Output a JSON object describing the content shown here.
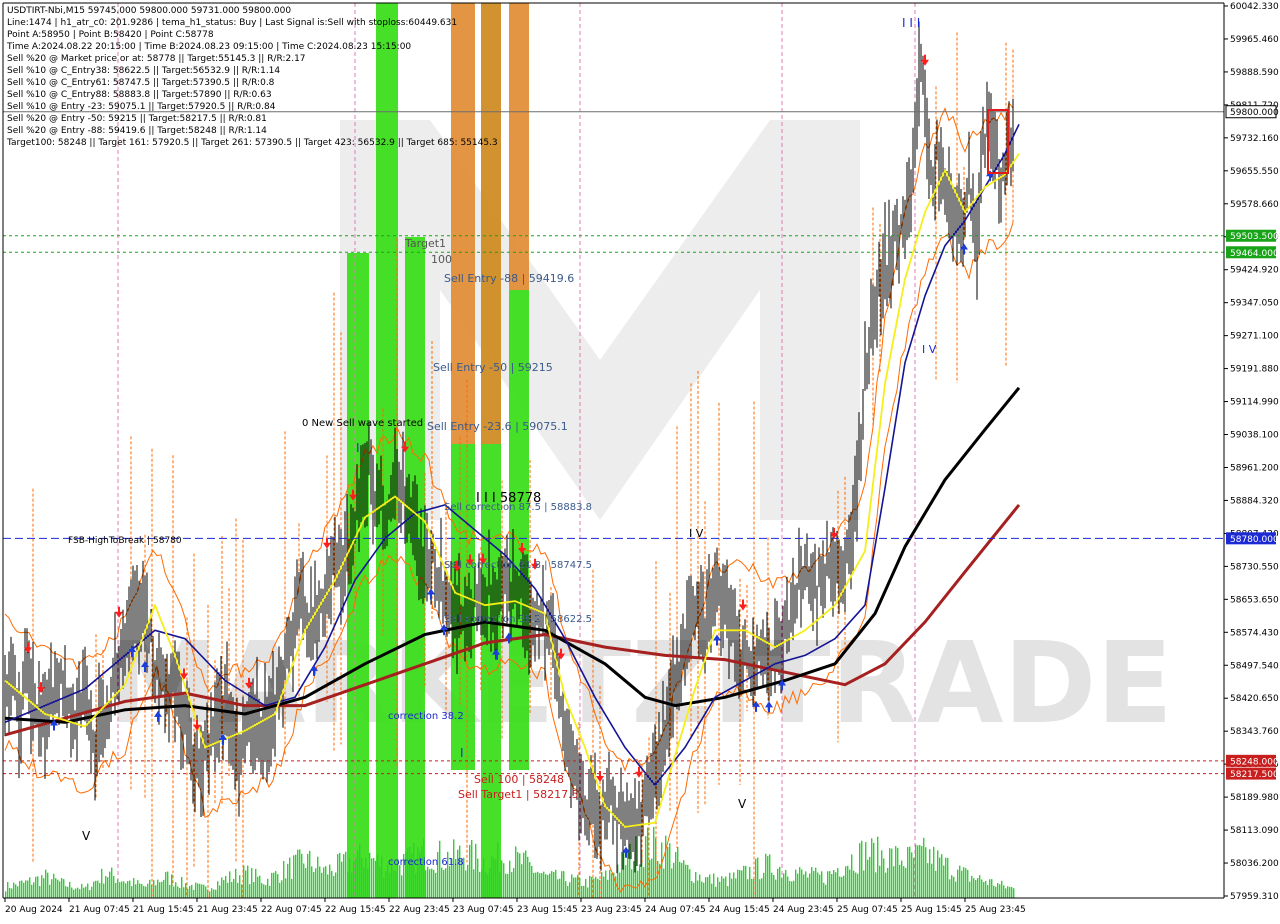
{
  "colors": {
    "background": "#ffffff",
    "axis": "#000000",
    "candle": "#000000",
    "ma_yellow": "#f5ee1a",
    "ma_blue": "#141496",
    "ma_black": "#000000",
    "ma_darkred": "#a5201e",
    "fib_orange": "#ff6a00",
    "zone_green": "#33dd11",
    "zone_orange": "#e08a30",
    "price_tag_blue": "#1c2ad4",
    "price_tag_green": "#18a318",
    "price_tag_red": "#c81e1e",
    "volume": "#33cc33",
    "arrow_sell": "#ff1e1e",
    "arrow_buy": "#1c3cdc",
    "current_price_tag": "#ffffff"
  },
  "header": {
    "lines": [
      "USDTIRT-Nbi,M15  59745.000 59800.000 59731.000 59800.000",
      "Line:1474  |  h1_atr_c0: 201.9286  |  tema_h1_status: Buy  |  Last Signal is:Sell with stoploss:60449.631",
      "Point A:58950  |  Point B:58420  |  Point C:58778",
      "Time A:2024.08.22 20:15:00  |  Time B:2024.08.23 09:15:00  |  Time C:2024.08.23 15:15:00",
      "Sell %20 @ Market price or at: 58778  ||  Target:55145.3  ||  R/R:2.17",
      "Sell %10 @ C_Entry38: 58622.5  ||  Target:56532.9  ||  R/R:1.14",
      "Sell %10 @ C_Entry61: 58747.5  ||  Target:57390.5  ||  R/R:0.8",
      "Sell %10 @ C_Entry88: 58883.8  ||  Target:57890  ||  R/R:0.63",
      "Sell %10 @ Entry -23: 59075.1  ||  Target:57920.5  ||  R/R:0.84",
      "Sell %20 @ Entry -50: 59215  ||  Target:58217.5  ||  R/R:0.81",
      "Sell %20 @ Entry -88: 59419.6  ||  Target:58248  ||  R/R:1.14",
      "Target100: 58248  ||  Target 161: 57920.5  ||  Target 261: 57390.5  ||  Target 423: 56532.9  ||  Target 685: 55145.3"
    ]
  },
  "chart_data": {
    "type": "candlestick",
    "symbol": "USDTIRT-Nbi",
    "timeframe": "M15",
    "ohlc_last": {
      "open": 59745.0,
      "high": 59800.0,
      "low": 59731.0,
      "close": 59800.0
    },
    "ylim": [
      57920,
      60060
    ],
    "y_ticks": [
      "60042.330",
      "59965.460",
      "59888.590",
      "59811.720",
      "59732.160",
      "59655.550",
      "59578.660",
      "59501.790",
      "59424.920",
      "59347.050",
      "59271.100",
      "59191.880",
      "59114.990",
      "59038.100",
      "58961.200",
      "58884.320",
      "58807.430",
      "58730.550",
      "58653.650",
      "58574.430",
      "58497.540",
      "58420.650",
      "58343.760",
      "58266.870",
      "58189.980",
      "58113.090",
      "58036.200",
      "57959.310"
    ],
    "x_ticks": [
      "20 Aug 2024",
      "21 Aug 07:45",
      "21 Aug 15:45",
      "21 Aug 23:45",
      "22 Aug 07:45",
      "22 Aug 15:45",
      "22 Aug 23:45",
      "23 Aug 07:45",
      "23 Aug 15:45",
      "23 Aug 23:45",
      "24 Aug 07:45",
      "24 Aug 15:45",
      "24 Aug 23:45",
      "25 Aug 07:45",
      "25 Aug 15:45",
      "25 Aug 23:45"
    ],
    "close_path": [
      [
        0,
        58410
      ],
      [
        8,
        58470
      ],
      [
        15,
        58330
      ],
      [
        20,
        58430
      ],
      [
        30,
        58380
      ],
      [
        36,
        58320
      ],
      [
        46,
        58420
      ],
      [
        55,
        58470
      ],
      [
        62,
        58390
      ],
      [
        72,
        58350
      ],
      [
        80,
        58430
      ],
      [
        88,
        58280
      ],
      [
        96,
        58340
      ],
      [
        104,
        58370
      ],
      [
        112,
        58480
      ],
      [
        120,
        58560
      ],
      [
        128,
        58620
      ],
      [
        136,
        58610
      ],
      [
        142,
        58560
      ],
      [
        150,
        58480
      ],
      [
        158,
        58420
      ],
      [
        166,
        58430
      ],
      [
        174,
        58390
      ],
      [
        182,
        58330
      ],
      [
        190,
        58240
      ],
      [
        196,
        58210
      ],
      [
        204,
        58290
      ],
      [
        212,
        58350
      ],
      [
        220,
        58420
      ],
      [
        228,
        58300
      ],
      [
        236,
        58260
      ],
      [
        244,
        58330
      ],
      [
        252,
        58350
      ],
      [
        260,
        58320
      ],
      [
        268,
        58390
      ],
      [
        276,
        58440
      ],
      [
        284,
        58520
      ],
      [
        292,
        58590
      ],
      [
        300,
        58640
      ],
      [
        308,
        58560
      ],
      [
        316,
        58620
      ],
      [
        324,
        58680
      ],
      [
        332,
        58710
      ],
      [
        340,
        58720
      ],
      [
        348,
        58780
      ],
      [
        356,
        58900
      ],
      [
        364,
        58930
      ],
      [
        372,
        58880
      ],
      [
        380,
        58820
      ],
      [
        388,
        58880
      ],
      [
        396,
        58940
      ],
      [
        404,
        58850
      ],
      [
        412,
        58780
      ],
      [
        420,
        58720
      ],
      [
        428,
        58760
      ],
      [
        436,
        58680
      ],
      [
        444,
        58640
      ],
      [
        452,
        58610
      ],
      [
        460,
        58600
      ],
      [
        468,
        58640
      ],
      [
        476,
        58620
      ],
      [
        484,
        58650
      ],
      [
        492,
        58600
      ],
      [
        500,
        58640
      ],
      [
        508,
        58650
      ],
      [
        516,
        58660
      ],
      [
        524,
        58600
      ],
      [
        532,
        58620
      ],
      [
        540,
        58560
      ],
      [
        548,
        58540
      ],
      [
        556,
        58400
      ],
      [
        564,
        58260
      ],
      [
        572,
        58200
      ],
      [
        580,
        58120
      ],
      [
        588,
        58160
      ],
      [
        596,
        58100
      ],
      [
        604,
        58180
      ],
      [
        612,
        58080
      ],
      [
        620,
        58140
      ],
      [
        628,
        58080
      ],
      [
        636,
        58130
      ],
      [
        644,
        58160
      ],
      [
        652,
        58220
      ],
      [
        660,
        58300
      ],
      [
        668,
        58400
      ],
      [
        676,
        58470
      ],
      [
        684,
        58560
      ],
      [
        692,
        58620
      ],
      [
        700,
        58580
      ],
      [
        708,
        58660
      ],
      [
        716,
        58620
      ],
      [
        724,
        58580
      ],
      [
        732,
        58540
      ],
      [
        740,
        58510
      ],
      [
        748,
        58470
      ],
      [
        756,
        58500
      ],
      [
        764,
        58480
      ],
      [
        772,
        58520
      ],
      [
        780,
        58540
      ],
      [
        788,
        58640
      ],
      [
        796,
        58680
      ],
      [
        804,
        58700
      ],
      [
        812,
        58650
      ],
      [
        820,
        58720
      ],
      [
        828,
        58690
      ],
      [
        836,
        58680
      ],
      [
        844,
        58760
      ],
      [
        852,
        58900
      ],
      [
        860,
        59150
      ],
      [
        868,
        59300
      ],
      [
        876,
        59390
      ],
      [
        884,
        59460
      ],
      [
        892,
        59500
      ],
      [
        900,
        59540
      ],
      [
        908,
        59650
      ],
      [
        914,
        59880
      ],
      [
        920,
        59820
      ],
      [
        926,
        59640
      ],
      [
        932,
        59700
      ],
      [
        940,
        59620
      ],
      [
        948,
        59540
      ],
      [
        956,
        59560
      ],
      [
        964,
        59600
      ],
      [
        972,
        59500
      ],
      [
        978,
        59740
      ],
      [
        984,
        59760
      ],
      [
        990,
        59700
      ],
      [
        996,
        59640
      ],
      [
        1002,
        59680
      ],
      [
        1008,
        59720
      ],
      [
        1014,
        59800
      ]
    ],
    "ma_yellow": [
      [
        0,
        58440
      ],
      [
        40,
        58360
      ],
      [
        80,
        58330
      ],
      [
        120,
        58430
      ],
      [
        150,
        58620
      ],
      [
        170,
        58500
      ],
      [
        200,
        58280
      ],
      [
        240,
        58320
      ],
      [
        270,
        58360
      ],
      [
        300,
        58560
      ],
      [
        330,
        58680
      ],
      [
        360,
        58830
      ],
      [
        390,
        58880
      ],
      [
        420,
        58820
      ],
      [
        450,
        58650
      ],
      [
        480,
        58620
      ],
      [
        510,
        58630
      ],
      [
        540,
        58600
      ],
      [
        560,
        58400
      ],
      [
        580,
        58280
      ],
      [
        600,
        58140
      ],
      [
        620,
        58090
      ],
      [
        650,
        58100
      ],
      [
        670,
        58260
      ],
      [
        690,
        58420
      ],
      [
        710,
        58560
      ],
      [
        740,
        58560
      ],
      [
        770,
        58520
      ],
      [
        800,
        58560
      ],
      [
        830,
        58620
      ],
      [
        860,
        58750
      ],
      [
        880,
        59150
      ],
      [
        900,
        59400
      ],
      [
        920,
        59560
      ],
      [
        940,
        59660
      ],
      [
        960,
        59560
      ],
      [
        980,
        59620
      ],
      [
        1000,
        59650
      ],
      [
        1014,
        59700
      ]
    ],
    "ma_blue": [
      [
        0,
        58340
      ],
      [
        40,
        58380
      ],
      [
        80,
        58420
      ],
      [
        120,
        58500
      ],
      [
        150,
        58560
      ],
      [
        180,
        58540
      ],
      [
        220,
        58440
      ],
      [
        260,
        58380
      ],
      [
        290,
        58400
      ],
      [
        320,
        58520
      ],
      [
        350,
        58680
      ],
      [
        380,
        58780
      ],
      [
        410,
        58840
      ],
      [
        440,
        58860
      ],
      [
        470,
        58800
      ],
      [
        500,
        58740
      ],
      [
        530,
        58660
      ],
      [
        560,
        58540
      ],
      [
        590,
        58400
      ],
      [
        620,
        58280
      ],
      [
        650,
        58190
      ],
      [
        680,
        58280
      ],
      [
        710,
        58400
      ],
      [
        740,
        58440
      ],
      [
        770,
        58480
      ],
      [
        800,
        58500
      ],
      [
        830,
        58540
      ],
      [
        860,
        58620
      ],
      [
        880,
        58900
      ],
      [
        900,
        59200
      ],
      [
        920,
        59360
      ],
      [
        940,
        59480
      ],
      [
        960,
        59540
      ],
      [
        980,
        59620
      ],
      [
        1000,
        59700
      ],
      [
        1014,
        59770
      ]
    ],
    "ma_black": [
      [
        0,
        58350
      ],
      [
        60,
        58340
      ],
      [
        120,
        58370
      ],
      [
        180,
        58380
      ],
      [
        240,
        58360
      ],
      [
        300,
        58400
      ],
      [
        360,
        58480
      ],
      [
        420,
        58550
      ],
      [
        480,
        58580
      ],
      [
        540,
        58560
      ],
      [
        600,
        58480
      ],
      [
        640,
        58400
      ],
      [
        670,
        58380
      ],
      [
        720,
        58400
      ],
      [
        780,
        58440
      ],
      [
        830,
        58480
      ],
      [
        870,
        58600
      ],
      [
        900,
        58760
      ],
      [
        940,
        58920
      ],
      [
        980,
        59040
      ],
      [
        1014,
        59140
      ]
    ],
    "ma_darkred": [
      [
        0,
        58310
      ],
      [
        60,
        58350
      ],
      [
        120,
        58390
      ],
      [
        180,
        58410
      ],
      [
        240,
        58380
      ],
      [
        300,
        58380
      ],
      [
        360,
        58430
      ],
      [
        420,
        58480
      ],
      [
        480,
        58530
      ],
      [
        540,
        58550
      ],
      [
        600,
        58520
      ],
      [
        660,
        58500
      ],
      [
        720,
        58490
      ],
      [
        780,
        58460
      ],
      [
        840,
        58430
      ],
      [
        880,
        58480
      ],
      [
        920,
        58580
      ],
      [
        960,
        58700
      ],
      [
        1014,
        58860
      ]
    ],
    "volume": [
      [
        0,
        12
      ],
      [
        20,
        16
      ],
      [
        40,
        22
      ],
      [
        60,
        14
      ],
      [
        80,
        10
      ],
      [
        100,
        26
      ],
      [
        120,
        18
      ],
      [
        140,
        12
      ],
      [
        160,
        22
      ],
      [
        180,
        14
      ],
      [
        200,
        10
      ],
      [
        220,
        20
      ],
      [
        240,
        26
      ],
      [
        260,
        18
      ],
      [
        280,
        30
      ],
      [
        300,
        40
      ],
      [
        320,
        28
      ],
      [
        340,
        36
      ],
      [
        360,
        44
      ],
      [
        380,
        34
      ],
      [
        400,
        38
      ],
      [
        420,
        48
      ],
      [
        440,
        42
      ],
      [
        460,
        46
      ],
      [
        480,
        38
      ],
      [
        500,
        44
      ],
      [
        520,
        36
      ],
      [
        540,
        22
      ],
      [
        560,
        20
      ],
      [
        580,
        16
      ],
      [
        600,
        22
      ],
      [
        620,
        40
      ],
      [
        640,
        56
      ],
      [
        660,
        52
      ],
      [
        680,
        30
      ],
      [
        700,
        20
      ],
      [
        720,
        18
      ],
      [
        740,
        26
      ],
      [
        760,
        34
      ],
      [
        780,
        30
      ],
      [
        800,
        24
      ],
      [
        820,
        22
      ],
      [
        840,
        38
      ],
      [
        860,
        48
      ],
      [
        880,
        44
      ],
      [
        900,
        40
      ],
      [
        920,
        46
      ],
      [
        940,
        34
      ],
      [
        960,
        24
      ],
      [
        980,
        18
      ],
      [
        1000,
        12
      ],
      [
        1014,
        8
      ]
    ],
    "levels": [
      {
        "label": "59800.000",
        "price": 59800.0,
        "color": "#000000",
        "tag": "current"
      },
      {
        "label": "59503.500",
        "price": 59503.5,
        "color": "#18a318",
        "tag": "green"
      },
      {
        "label": "59464.000",
        "price": 59464.0,
        "color": "#18a318",
        "tag": "green"
      },
      {
        "label": "58780.000",
        "price": 58780.0,
        "color": "#1c2ad4",
        "tag": "blue"
      },
      {
        "label": "58248.000",
        "price": 58248.0,
        "color": "#c81e1e",
        "tag": "red"
      },
      {
        "label": "58217.500",
        "price": 58217.5,
        "color": "#c81e1e",
        "tag": "red"
      }
    ],
    "annotations": [
      {
        "text": "Target1",
        "color": "#555555"
      },
      {
        "text": "100",
        "color": "#555555"
      },
      {
        "text": "Sell Entry -88 | 59419.6",
        "color": "#3a5a8a"
      },
      {
        "text": "Sell Entry -50 | 59215",
        "color": "#3a5a8a"
      },
      {
        "text": "0 New Sell wave started",
        "color": "#000000"
      },
      {
        "text": "Sell Entry -23.6 | 59075.1",
        "color": "#3a5a8a"
      },
      {
        "text": "I I I 58778",
        "color": "#000000"
      },
      {
        "text": "Sell correction 87.5 | 58883.8",
        "color": "#3a5a8a"
      },
      {
        "text": "Sell correction 61.8 | 58747.5",
        "color": "#3a5a8a"
      },
      {
        "text": "Sell correction 38.2 | 58622.5",
        "color": "#3a5a8a"
      },
      {
        "text": "FSB-HighToBreak | 58780",
        "color": "#000000"
      },
      {
        "text": "correction 38.2",
        "color": "#1c2ad4"
      },
      {
        "text": "correction 61.8",
        "color": "#1c2ad4"
      },
      {
        "text": "Sell 100 | 58248",
        "color": "#c81e1e"
      },
      {
        "text": "Sell Target1 | 58217.5",
        "color": "#c81e1e"
      },
      {
        "text": "I V",
        "color": "#000000"
      },
      {
        "text": "V",
        "color": "#000000"
      },
      {
        "text": "I I I",
        "color": "#1c2ad4"
      },
      {
        "text": "I V",
        "color": "#1c2ad4"
      },
      {
        "text": "I",
        "color": "#1c2ad4"
      },
      {
        "text": "I",
        "color": "#1c2ad4"
      },
      {
        "text": "V",
        "color": "#000000"
      }
    ],
    "watermark": "MARKETZITRADE"
  }
}
